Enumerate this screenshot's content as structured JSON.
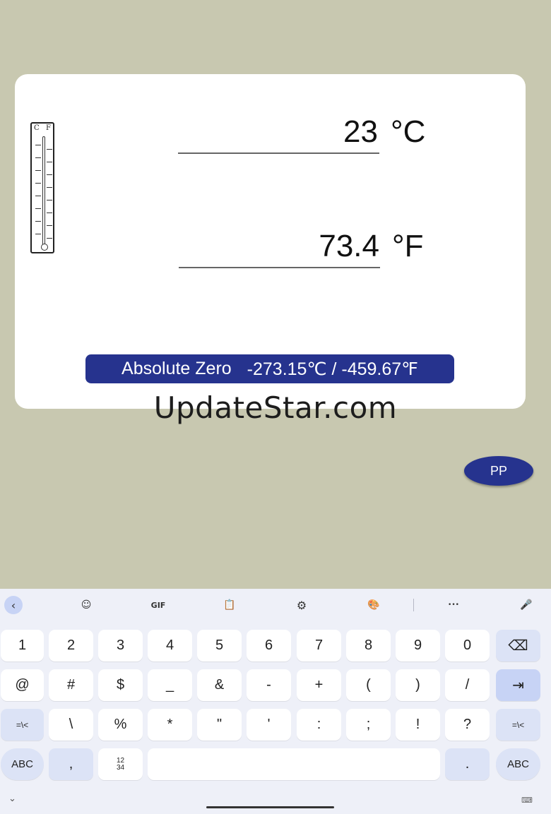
{
  "converter": {
    "thermometer_labels": {
      "celsius": "C",
      "fahrenheit": "F"
    },
    "celsius": {
      "value": "23",
      "unit": "°C"
    },
    "fahrenheit": {
      "value": "73.4",
      "unit": "°F"
    },
    "absolute_zero": {
      "label": "Absolute Zero",
      "value": "-273.15℃ / -459.67℉"
    }
  },
  "watermark": "UpdateStar.com",
  "fab": {
    "label": "PP"
  },
  "keyboard": {
    "toolbar": {
      "back": "‹",
      "sticker": "☺",
      "gif": "GIF",
      "clipboard": "📋",
      "settings": "⚙",
      "theme": "🎨",
      "more": "•••",
      "mic": "🎤"
    },
    "row1": [
      "1",
      "2",
      "3",
      "4",
      "5",
      "6",
      "7",
      "8",
      "9",
      "0",
      "⌫"
    ],
    "row2": [
      "@",
      "#",
      "$",
      "_",
      "&",
      "-",
      "+",
      "(",
      ")",
      "/",
      "⇥"
    ],
    "row3": [
      "=\\<",
      "\\",
      "%",
      "*",
      "\"",
      "'",
      ":",
      ";",
      "!",
      "?",
      "=\\<"
    ],
    "row4": {
      "abc_left": "ABC",
      "comma": ",",
      "numpad": "12\n34",
      "space": "",
      "period": ".",
      "abc_right": "ABC"
    },
    "hide": "⌄",
    "kbd_icon": "⌨"
  },
  "colors": {
    "background": "#c8c8b0",
    "accent": "#26338e",
    "card": "#ffffff",
    "keyboard": "#eef0f8"
  }
}
